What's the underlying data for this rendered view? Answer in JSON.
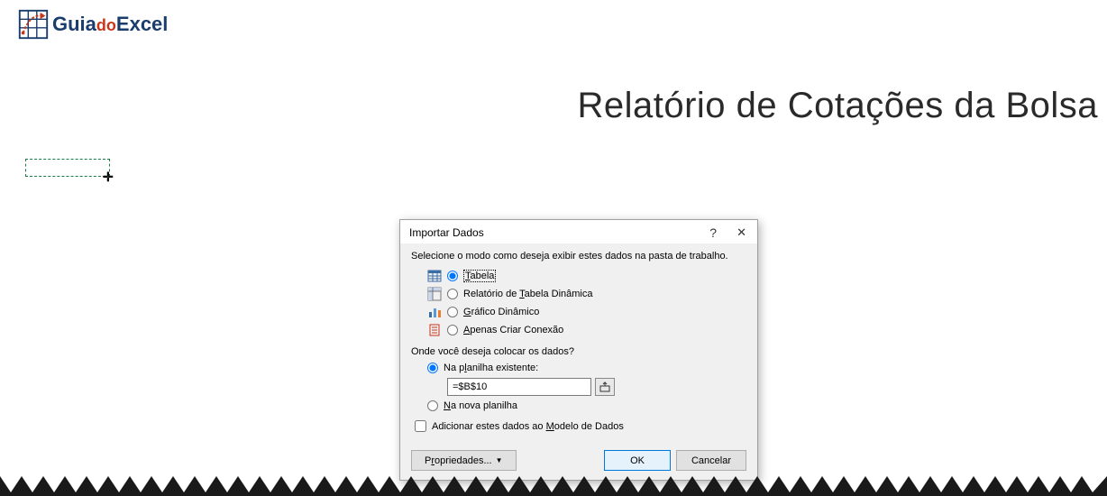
{
  "logo": {
    "guia": "Guia",
    "do": "do",
    "excel": "Excel"
  },
  "page_title": "Relatório de Cotações da Bolsa",
  "dialog": {
    "title": "Importar Dados",
    "instruction": "Selecione o modo como deseja exibir estes dados na pasta de trabalho.",
    "options": {
      "table": "Tabela",
      "pivot_report": "Relatório de Tabela Dinâmica",
      "pivot_chart": "Gráfico Dinâmico",
      "connection_only": "Apenas Criar Conexão"
    },
    "location_label": "Onde você deseja colocar os dados?",
    "location": {
      "existing": "Na planilha existente:",
      "ref_value": "=$B$10",
      "new_sheet": "Na nova planilha"
    },
    "add_to_model": "Adicionar estes dados ao Modelo de Dados",
    "buttons": {
      "properties": "Propriedades...",
      "ok": "OK",
      "cancel": "Cancelar"
    }
  }
}
